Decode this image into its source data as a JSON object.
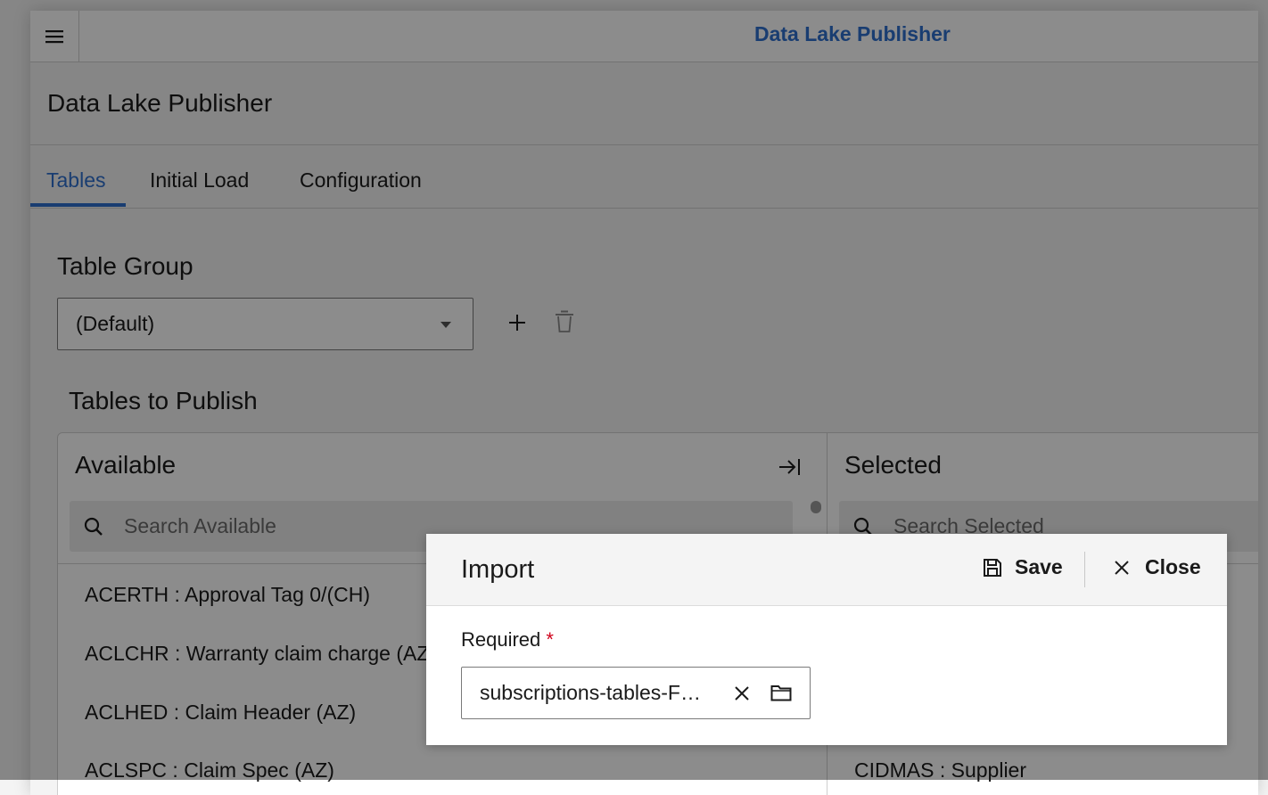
{
  "app": {
    "title": "Data Lake Publisher",
    "accent_color": "#2f6fce"
  },
  "page": {
    "title": "Data Lake Publisher"
  },
  "tabs": [
    {
      "label": "Tables",
      "active": true
    },
    {
      "label": "Initial Load",
      "active": false
    },
    {
      "label": "Configuration",
      "active": false
    }
  ],
  "table_group": {
    "heading": "Table Group",
    "selected_value": "(Default)",
    "add_icon": "plus-icon",
    "delete_icon": "trash-icon"
  },
  "tables_to_publish": {
    "heading": "Tables to Publish",
    "available": {
      "title": "Available",
      "search_placeholder": "Search Available",
      "move_all_icon": "move-all-right-icon",
      "items": [
        "ACERTH : Approval Tag 0/(CH)",
        "ACLCHR : Warranty claim charge (AZ)",
        "ACLHED : Claim Header (AZ)",
        "ACLSPC : Claim Spec (AZ)"
      ]
    },
    "selected": {
      "title": "Selected",
      "search_placeholder": "Search Selected",
      "items": [
        "CIDMAS : Supplier"
      ]
    }
  },
  "import_dialog": {
    "title": "Import",
    "save_label": "Save",
    "close_label": "Close",
    "field_label": "Required",
    "required_marker": "*",
    "file_value": "subscriptions-tables-F…"
  }
}
